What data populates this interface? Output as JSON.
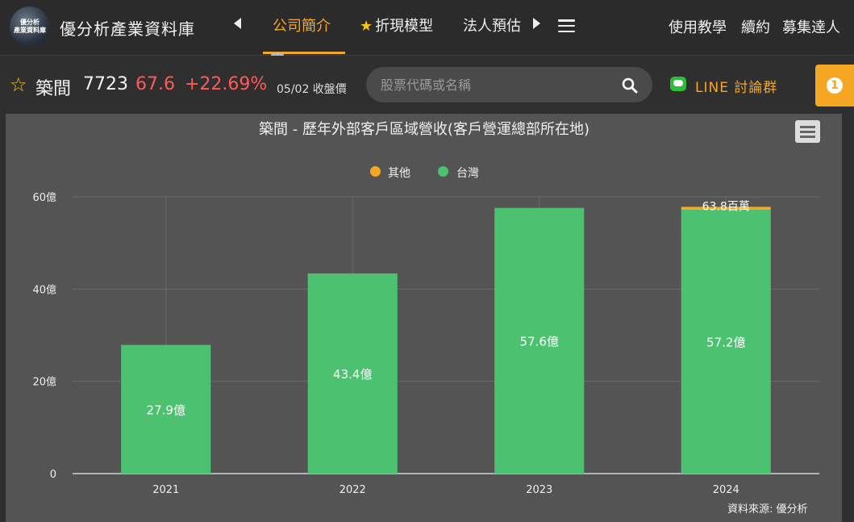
{
  "nav": {
    "logo_line1": "優分析",
    "logo_line2": "產業資料庫",
    "brand": "優分析產業資料庫",
    "tabs": [
      {
        "label": "公司簡介",
        "active": true
      },
      {
        "label": "折現模型",
        "starred": true
      },
      {
        "label": "法人預估",
        "clipped": true
      }
    ],
    "right_links": [
      "使用教學",
      "續約",
      "募集達人"
    ]
  },
  "stock": {
    "name": "築間",
    "code": "7723",
    "price": "67.6",
    "change": "+22.69%",
    "date_label": "05/02 收盤價",
    "search_placeholder": "股票代碼或名稱",
    "line_group": "LINE 討論群",
    "notification_count": "1",
    "price_color": "#ff5a5a"
  },
  "chart_data": {
    "type": "bar",
    "stacked": true,
    "title": "築間 - 歷年外部客戶區域營收(客戶營運總部所在地)",
    "categories": [
      "2021",
      "2022",
      "2023",
      "2024"
    ],
    "series": [
      {
        "name": "台灣",
        "color": "#4cc170",
        "values": [
          27.9,
          43.4,
          57.6,
          57.2
        ],
        "labels": [
          "27.9億",
          "43.4億",
          "57.6億",
          "57.2億"
        ]
      },
      {
        "name": "其他",
        "color": "#f5a623",
        "values": [
          0,
          0,
          0,
          0.638
        ],
        "labels": [
          "",
          "",
          "",
          "63.8百萬"
        ]
      }
    ],
    "legend_order": [
      "其他",
      "台灣"
    ],
    "legend_position": "top-center",
    "y_ticks": [
      "0",
      "20億",
      "40億",
      "60億"
    ],
    "y_tick_values": [
      0,
      20,
      40,
      60
    ],
    "ylim": [
      0,
      60
    ],
    "grid": true,
    "source": "資料來源: 優分析"
  }
}
